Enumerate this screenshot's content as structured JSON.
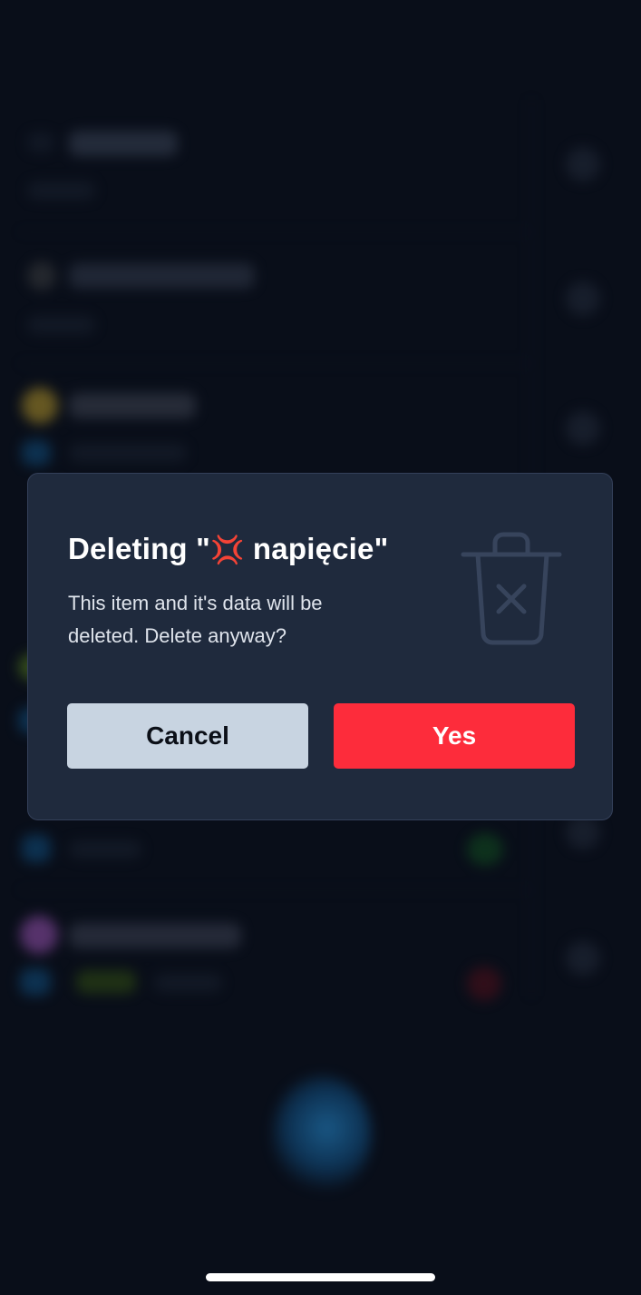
{
  "dialog": {
    "title_prefix": "Deleting \"",
    "title_emoji": "💢",
    "title_name": " napięcie\"",
    "message": "This item and it's data will be deleted. Delete anyway?",
    "cancel_label": "Cancel",
    "confirm_label": "Yes",
    "icon": "trash-x-icon"
  },
  "colors": {
    "dialog_bg": "#1f2a3d",
    "confirm_button": "#fd2c3b",
    "cancel_button": "#c8d4e1",
    "backdrop": "#090e19"
  }
}
